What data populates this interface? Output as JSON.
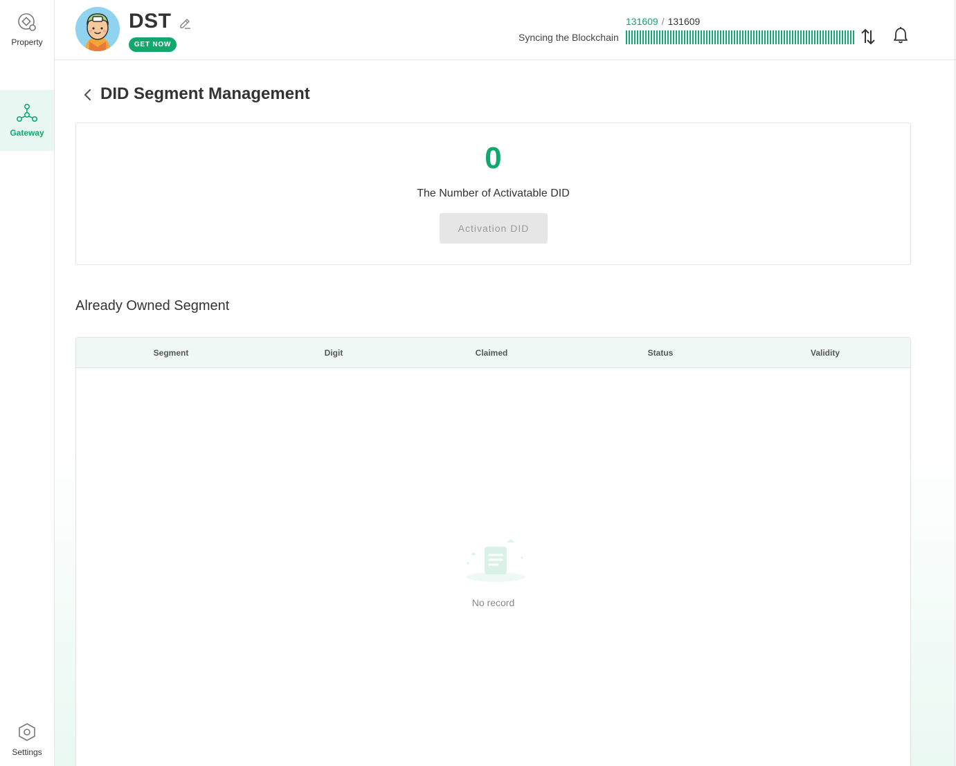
{
  "sidebar": {
    "items": [
      {
        "label": "Property",
        "icon": "property-icon"
      },
      {
        "label": "Gateway",
        "icon": "gateway-icon",
        "active": true
      },
      {
        "label": "Settings",
        "icon": "settings-icon"
      }
    ]
  },
  "header": {
    "wallet_name": "DST",
    "get_now_label": "GET NOW",
    "sync_label": "Syncing the Blockchain",
    "sync_current": "131609",
    "sync_separator": "/",
    "sync_total": "131609",
    "sync_progress": 1.0
  },
  "page": {
    "title": "DID Segment Management",
    "activatable_count": "0",
    "activatable_label": "The Number of Activatable DID",
    "activation_button": "Activation DID",
    "activation_button_disabled": true,
    "section_title": "Already Owned Segment"
  },
  "table": {
    "columns": [
      "Segment",
      "Digit",
      "Claimed",
      "Status",
      "Validity"
    ],
    "rows": [],
    "empty_text": "No record"
  },
  "colors": {
    "accent": "#11a86e",
    "active_nav_bg": "#e8f7f1",
    "table_header_bg": "#f0f8f5"
  }
}
